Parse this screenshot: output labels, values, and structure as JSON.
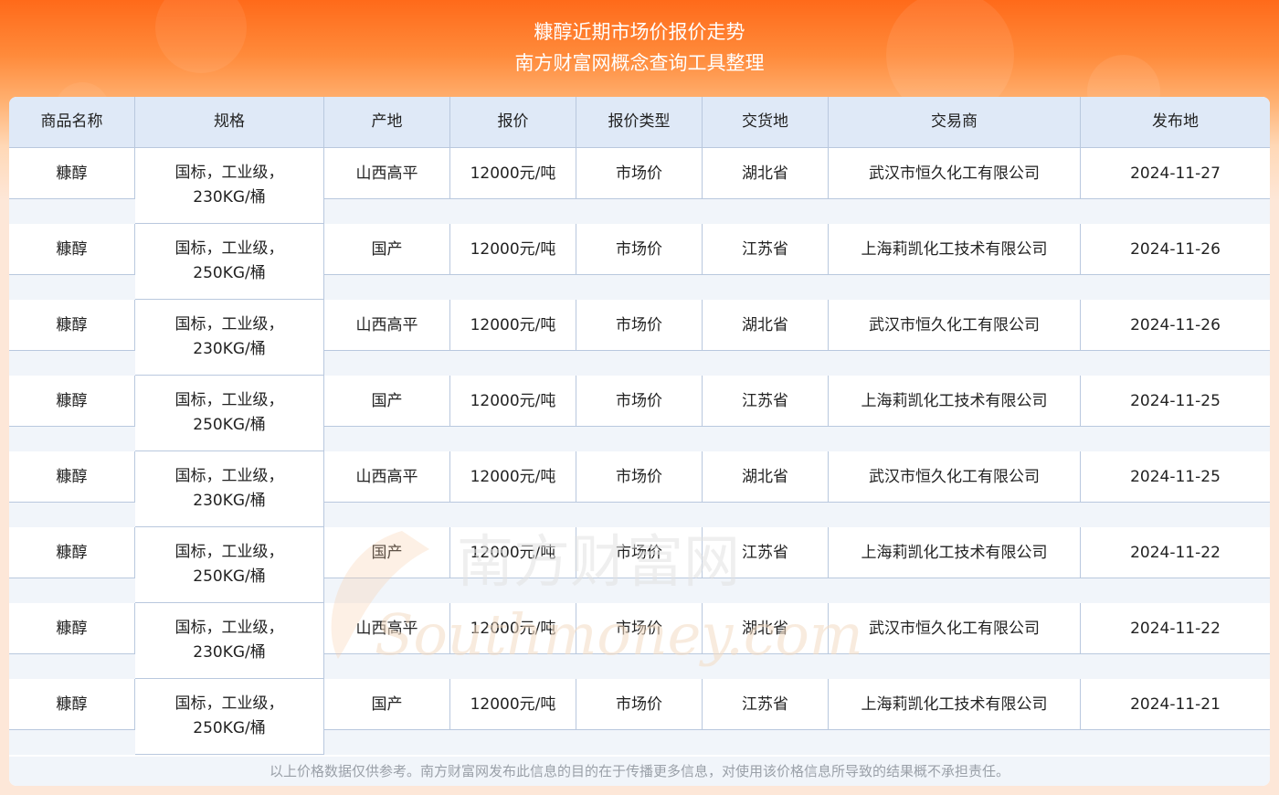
{
  "header": {
    "title_line1": "糠醇近期市场价报价走势",
    "title_line2": "南方财富网概念查询工具整理"
  },
  "table": {
    "columns": [
      "商品名称",
      "规格",
      "产地",
      "报价",
      "报价类型",
      "交货地",
      "交易商",
      "发布地"
    ],
    "rows": [
      {
        "name": "糠醇",
        "spec1": "国标，工业级，",
        "spec2": "230KG/桶",
        "origin": "山西高平",
        "price": "12000元/吨",
        "price_type": "市场价",
        "delivery": "湖北省",
        "trader": "武汉市恒久化工有限公司",
        "date": "2024-11-27"
      },
      {
        "name": "糠醇",
        "spec1": "国标，工业级，",
        "spec2": "250KG/桶",
        "origin": "国产",
        "price": "12000元/吨",
        "price_type": "市场价",
        "delivery": "江苏省",
        "trader": "上海莉凯化工技术有限公司",
        "date": "2024-11-26"
      },
      {
        "name": "糠醇",
        "spec1": "国标，工业级，",
        "spec2": "230KG/桶",
        "origin": "山西高平",
        "price": "12000元/吨",
        "price_type": "市场价",
        "delivery": "湖北省",
        "trader": "武汉市恒久化工有限公司",
        "date": "2024-11-26"
      },
      {
        "name": "糠醇",
        "spec1": "国标，工业级，",
        "spec2": "250KG/桶",
        "origin": "国产",
        "price": "12000元/吨",
        "price_type": "市场价",
        "delivery": "江苏省",
        "trader": "上海莉凯化工技术有限公司",
        "date": "2024-11-25"
      },
      {
        "name": "糠醇",
        "spec1": "国标，工业级，",
        "spec2": "230KG/桶",
        "origin": "山西高平",
        "price": "12000元/吨",
        "price_type": "市场价",
        "delivery": "湖北省",
        "trader": "武汉市恒久化工有限公司",
        "date": "2024-11-25"
      },
      {
        "name": "糠醇",
        "spec1": "国标，工业级，",
        "spec2": "250KG/桶",
        "origin": "国产",
        "price": "12000元/吨",
        "price_type": "市场价",
        "delivery": "江苏省",
        "trader": "上海莉凯化工技术有限公司",
        "date": "2024-11-22"
      },
      {
        "name": "糠醇",
        "spec1": "国标，工业级，",
        "spec2": "230KG/桶",
        "origin": "山西高平",
        "price": "12000元/吨",
        "price_type": "市场价",
        "delivery": "湖北省",
        "trader": "武汉市恒久化工有限公司",
        "date": "2024-11-22"
      },
      {
        "name": "糠醇",
        "spec1": "国标，工业级，",
        "spec2": "250KG/桶",
        "origin": "国产",
        "price": "12000元/吨",
        "price_type": "市场价",
        "delivery": "江苏省",
        "trader": "上海莉凯化工技术有限公司",
        "date": "2024-11-21"
      }
    ]
  },
  "footer": {
    "disclaimer": "以上价格数据仅供参考。南方财富网发布此信息的目的在于传播更多信息，对使用该价格信息所导致的结果概不承担责任。"
  },
  "watermark": {
    "cn": "南方财富网",
    "en": "Southmoney.com"
  },
  "colors": {
    "header_orange": "#ff6a1a",
    "table_header_bg": "#dfe9f7",
    "grid_line": "#b9c8de",
    "band_bg": "#f1f5fa",
    "footer_text": "#9aa0a8"
  }
}
